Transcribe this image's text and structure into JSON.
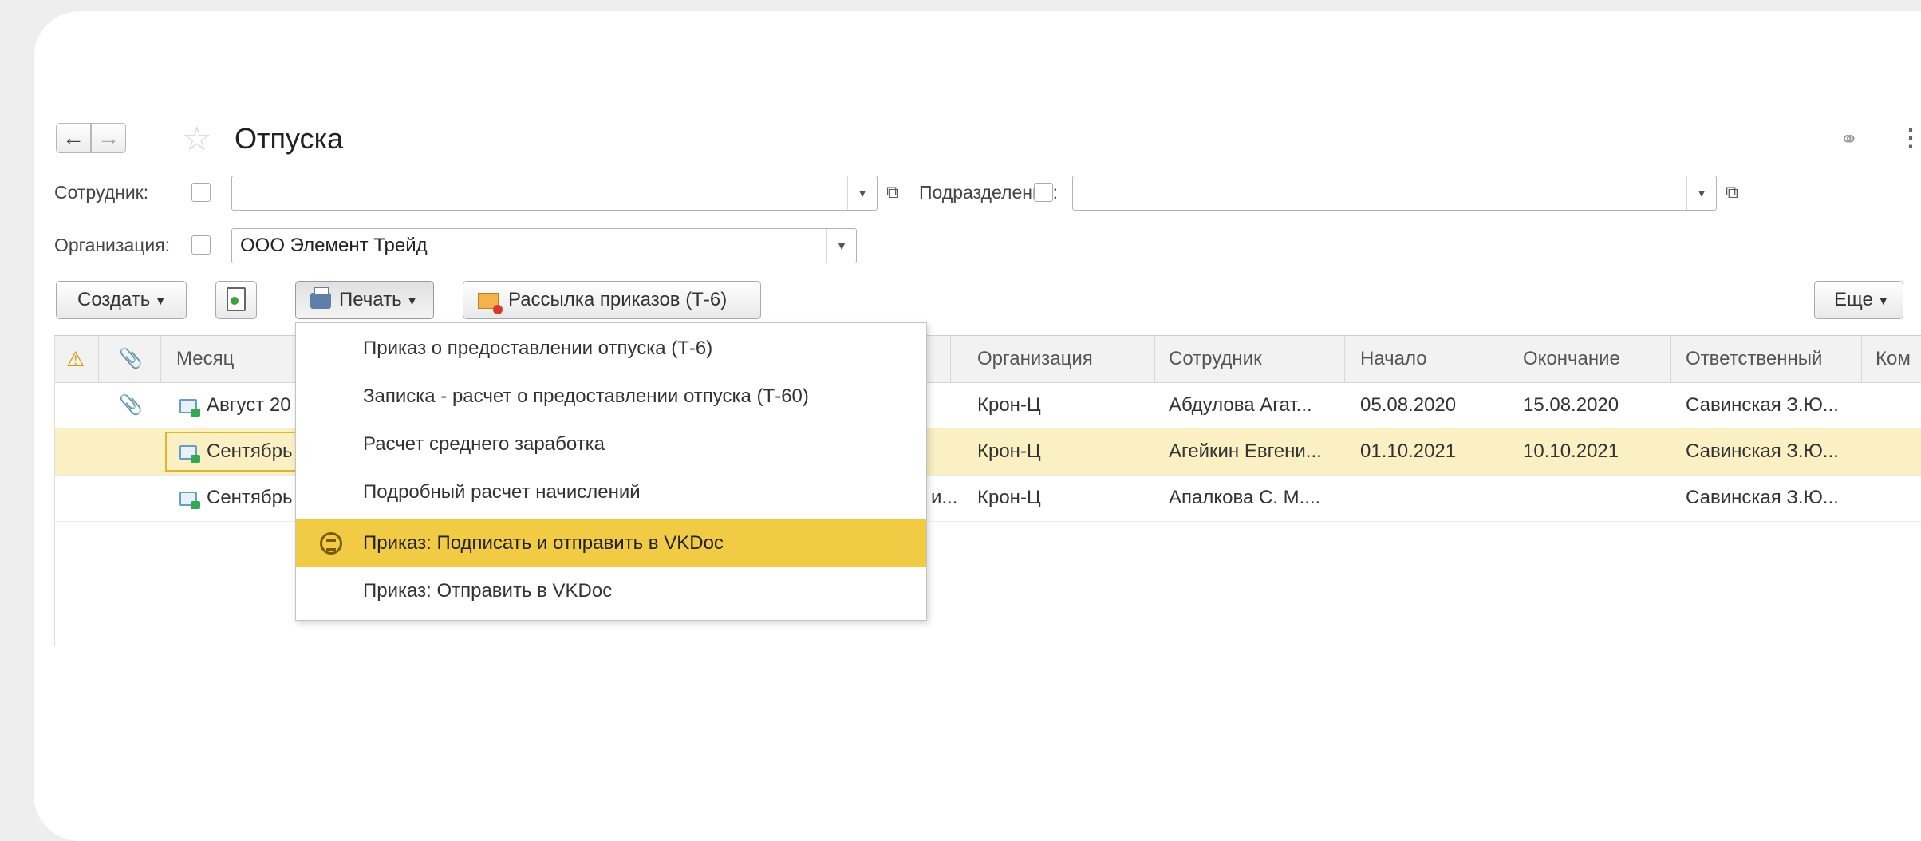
{
  "window": {
    "title": "Отпуска",
    "back_icon": "arrow-left-icon",
    "forward_icon": "arrow-right-icon",
    "favorite_icon": "star-icon",
    "link_icon": "link-icon",
    "menu_icon": "more-vertical-icon"
  },
  "filters": {
    "employee_label": "Сотрудник:",
    "employee_value": "",
    "division_label": "Подразделение:",
    "division_value": "",
    "organization_label": "Организация:",
    "organization_value": "ООО Элемент Трейд"
  },
  "toolbar": {
    "create_label": "Создать",
    "print_label": "Печать",
    "mailing_label": "Рассылка приказов (Т-6)",
    "more_label": "Еще"
  },
  "table": {
    "columns": [
      "Месяц",
      "Организация",
      "Сотрудник",
      "Начало",
      "Окончание",
      "Ответственный",
      "Ком"
    ],
    "rows": [
      {
        "month": "Август 20",
        "extra": "",
        "organization": "Крон-Ц",
        "employee": "Абдулова Агат...",
        "start": "05.08.2020",
        "end": "15.08.2020",
        "responsible": "Савинская З.Ю..."
      },
      {
        "month": "Сентябрь",
        "extra": "",
        "organization": "Крон-Ц",
        "employee": "Агейкин Евгени...",
        "start": "01.10.2021",
        "end": "10.10.2021",
        "responsible": "Савинская З.Ю..."
      },
      {
        "month": "Сентябрь",
        "extra": "и...",
        "organization": "Крон-Ц",
        "employee": "Апалкова С. М....",
        "start": "",
        "end": "",
        "responsible": "Савинская З.Ю..."
      }
    ]
  },
  "print_menu": {
    "items": [
      "Приказ о предоставлении отпуска (Т-6)",
      "Записка - расчет о предоставлении отпуска (Т-60)",
      "Расчет среднего заработка",
      "Подробный расчет начислений",
      "Приказ: Подписать и отправить в VKDoc",
      "Приказ: Отправить в VKDoc"
    ],
    "active_index": 4
  },
  "colors": {
    "accent": "#f2cb45",
    "selected_row": "#fbf0c4",
    "selection_border": "#e0b62f"
  }
}
